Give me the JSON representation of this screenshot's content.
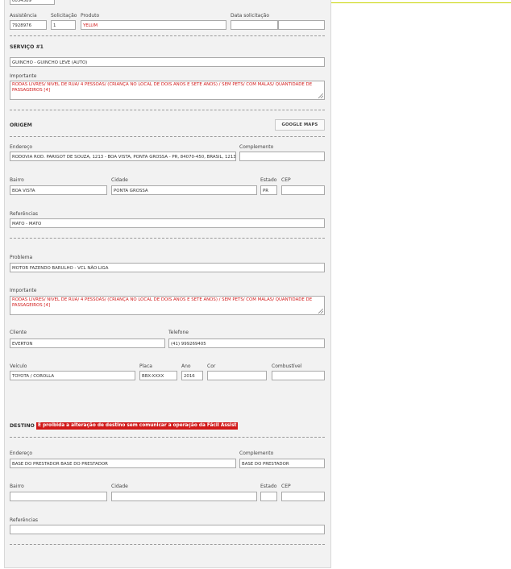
{
  "top": {
    "partial_value": "0054589"
  },
  "header": {
    "assistencia": {
      "label": "Assistência",
      "value": "7928976"
    },
    "solicitacao": {
      "label": "Solicitação",
      "value": "1"
    },
    "produto": {
      "label": "Produto",
      "value": "YELUM"
    },
    "data_solicitacao": {
      "label": "Data solicitação",
      "date": "",
      "time": ""
    }
  },
  "servico": {
    "title": "SERVIÇO #1",
    "value": "GUINCHO - GUINCHO LEVE (AUTO)",
    "importante_label": "Importante",
    "importante_value": "RODAS LIVRES/ NIVEL DE RUA/ 4 PESSOAS/ (CRIANÇA NO LOCAL DE DOIS ANOS E SETE ANOS) / SEM PETS/ COM MALAS/ QUANTIDADE DE PASSAGEIROS [4]"
  },
  "origem": {
    "title": "ORIGEM",
    "maps_button": "GOOGLE MAPS",
    "endereco": {
      "label": "Endereço",
      "value": "RODOVIA ROD. PARIGOT DE SOUZA, 1213 - BOA VISTA, PONTA GROSSA - PR, 84070-450, BRASIL, 1213"
    },
    "complemento": {
      "label": "Complemento",
      "value": ""
    },
    "bairro": {
      "label": "Bairro",
      "value": "BOA VISTA"
    },
    "cidade": {
      "label": "Cidade",
      "value": "PONTA GROSSA"
    },
    "estado": {
      "label": "Estado",
      "value": "PR"
    },
    "cep": {
      "label": "CEP",
      "value": ""
    },
    "referencias": {
      "label": "Referências",
      "value": "MATO - MATO"
    }
  },
  "problema": {
    "label": "Problema",
    "value": "MOTOR FAZENDO BARULHO - VCL NÃO LIGA",
    "importante_label": "Importante",
    "importante_value": "RODAS LIVRES/ NIVEL DE RUA/ 4 PESSOAS/ (CRIANÇA NO LOCAL DE DOIS ANOS E SETE ANOS) / SEM PETS/ COM MALAS/ QUANTIDADE DE PASSAGEIROS [4]"
  },
  "cliente": {
    "label": "Cliente",
    "value": "EVERTON"
  },
  "telefone": {
    "label": "Telefone",
    "value": "(41) 999269405"
  },
  "veiculo": {
    "veiculo": {
      "label": "Veículo",
      "value": "TOYOTA / COROLLA"
    },
    "placa": {
      "label": "Placa",
      "value": "BBX-XXXX"
    },
    "ano": {
      "label": "Ano",
      "value": "2016"
    },
    "cor": {
      "label": "Cor",
      "value": ""
    },
    "combustivel": {
      "label": "Combustível",
      "value": ""
    }
  },
  "destino": {
    "title": "DESTINO",
    "warning": "É proibida a alteração de destino sem comunicar a operação da Fácil Assist",
    "endereco": {
      "label": "Endereço",
      "value": "BASE DO PRESTADOR BASE DO PRESTADOR"
    },
    "complemento": {
      "label": "Complemento",
      "value": "BASE DO PRESTADOR"
    },
    "bairro": {
      "label": "Bairro",
      "value": ""
    },
    "cidade": {
      "label": "Cidade",
      "value": ""
    },
    "estado": {
      "label": "Estado",
      "value": ""
    },
    "cep": {
      "label": "CEP",
      "value": ""
    },
    "referencias": {
      "label": "Referências",
      "value": ""
    }
  },
  "colors": {
    "accent_line": "#c8d400",
    "warning_bg": "#d11a1a",
    "alert_text": "#d11a1a"
  }
}
